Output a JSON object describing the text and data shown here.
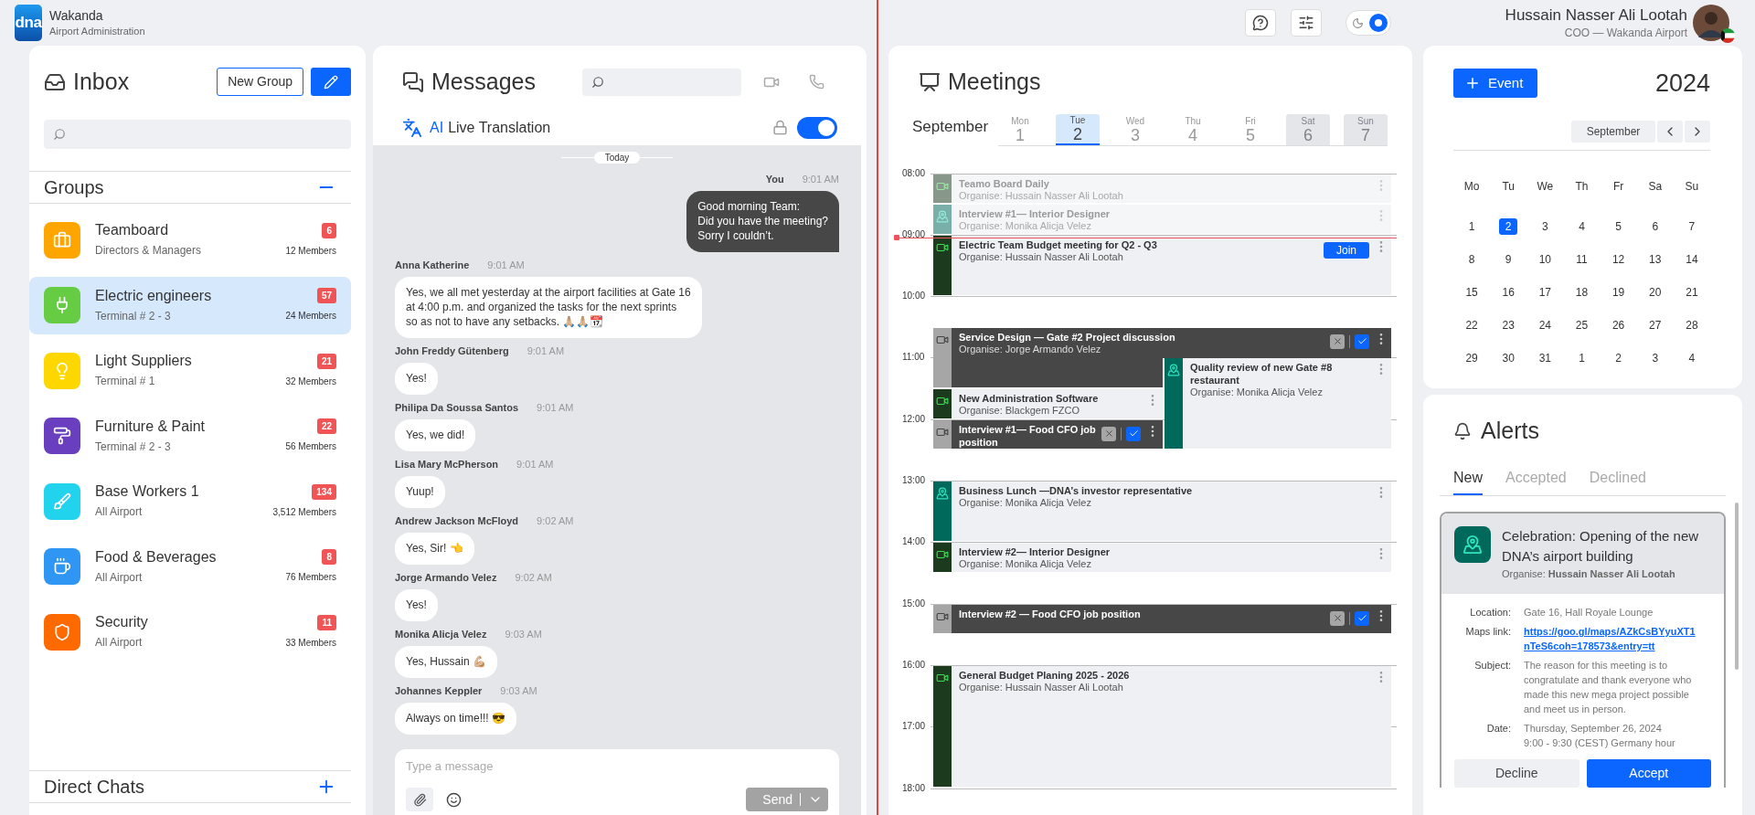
{
  "app": {
    "logo": "dna",
    "name": "Wakanda",
    "subtitle": "Airport Administration"
  },
  "header": {
    "theme_toggle": {
      "on": true
    },
    "user": {
      "name": "Hussain Nasser Ali Lootah",
      "role": "COO — Wakanda Airport"
    }
  },
  "inbox": {
    "title": "Inbox",
    "new_group": "New Group",
    "groups_title": "Groups",
    "direct_chats_title": "Direct Chats",
    "groups": [
      {
        "name": "Teamboard",
        "subtitle": "Directors & Managers",
        "unread": "6",
        "members": "12 Members",
        "color": "#ffa500",
        "selected": false
      },
      {
        "name": "Electric engineers",
        "subtitle": "Terminal # 2 - 3",
        "unread": "57",
        "members": "24 Members",
        "color": "#66cc44",
        "selected": true
      },
      {
        "name": "Light Suppliers",
        "subtitle": "Terminal # 1",
        "unread": "21",
        "members": "32 Members",
        "color": "#ffd700",
        "selected": false
      },
      {
        "name": "Furniture & Paint",
        "subtitle": "Terminal # 2 - 3",
        "unread": "22",
        "members": "56 Members",
        "color": "#6a3fbf",
        "selected": false
      },
      {
        "name": "Base Workers 1",
        "subtitle": "All Airport",
        "unread": "134",
        "members": "3,512 Members",
        "color": "#22d3ee",
        "selected": false
      },
      {
        "name": "Food & Beverages",
        "subtitle": "All Airport",
        "unread": "8",
        "members": "76 Members",
        "color": "#2f96f3",
        "selected": false
      },
      {
        "name": "Security",
        "subtitle": "All Airport",
        "unread": "11",
        "members": "33 Members",
        "color": "#ff6a00",
        "selected": false
      }
    ]
  },
  "messages": {
    "title": "Messages",
    "translation": {
      "prefix": "AI",
      "label": "Live Translation",
      "on": true
    },
    "divider": "Today",
    "items": [
      {
        "sender": "You",
        "time": "9:01 AM",
        "text": "Good morning Team:\nDid you have the meeting?\nSorry I couldn’t.",
        "mine": true
      },
      {
        "sender": "Anna Katherine",
        "time": "9:01 AM",
        "text": "Yes, we all met yesterday at the airport facilities at Gate 16 at 4:00 p.m. and organized the tasks for the next sprints so as not to have any setbacks. 🙏🏼🙏🏼📆",
        "mine": false
      },
      {
        "sender": "John Freddy Gütenberg",
        "time": "9:01 AM",
        "text": "Yes!",
        "mine": false
      },
      {
        "sender": "Philipa Da Soussa Santos",
        "time": "9:01 AM",
        "text": "Yes, we did!",
        "mine": false
      },
      {
        "sender": "Lisa Mary McPherson",
        "time": "9:01 AM",
        "text": "Yuup!",
        "mine": false
      },
      {
        "sender": "Andrew Jackson McFloyd",
        "time": "9:02 AM",
        "text": "Yes, Sir! 👈",
        "mine": false
      },
      {
        "sender": "Jorge Armando Velez",
        "time": "9:02 AM",
        "text": "Yes!",
        "mine": false
      },
      {
        "sender": "Monika Alicja Velez",
        "time": "9:03 AM",
        "text": "Yes, Hussain 💪🏼",
        "mine": false
      },
      {
        "sender": "Johannes Keppler",
        "time": "9:03 AM",
        "text": "Always on time!!! 😎",
        "mine": false
      }
    ],
    "composer": {
      "placeholder": "Type a message",
      "send": "Send"
    }
  },
  "meetings": {
    "title": "Meetings",
    "month": "September",
    "days": [
      {
        "weekday": "Mon",
        "day": "1",
        "selected": false,
        "weekend": false
      },
      {
        "weekday": "Tue",
        "day": "2",
        "selected": true,
        "weekend": false
      },
      {
        "weekday": "Wed",
        "day": "3",
        "selected": false,
        "weekend": false
      },
      {
        "weekday": "Thu",
        "day": "4",
        "selected": false,
        "weekend": false
      },
      {
        "weekday": "Fri",
        "day": "5",
        "selected": false,
        "weekend": false
      },
      {
        "weekday": "Sat",
        "day": "6",
        "selected": false,
        "weekend": true
      },
      {
        "weekday": "Sun",
        "day": "7",
        "selected": false,
        "weekend": true
      }
    ],
    "hours": [
      "08:00",
      "09:00",
      "10:00",
      "11:00",
      "12:00",
      "13:00",
      "14:00",
      "15:00",
      "16:00",
      "17:00",
      "18:00"
    ],
    "events": [
      {
        "title": "Teamo Board Daily",
        "organiser": "Organise: Hussain Nasser Ali Lootah",
        "kind": "video",
        "past": true
      },
      {
        "title": "Interview #1— Interior Designer",
        "organiser": "Organise: Monika Alicja Velez",
        "kind": "place",
        "past": true
      },
      {
        "title": "Electric Team Budget meeting for Q2 - Q3",
        "organiser": "Organise: Hussain Nasser Ali Lootah",
        "kind": "video",
        "past": false,
        "join": "Join"
      },
      {
        "title": "Service Design — Gate #2 Project discussion",
        "organiser": "Organise: Jorge Armando Velez",
        "kind": "pending",
        "past": false
      },
      {
        "title": "Quality review of new Gate #8 restaurant",
        "organiser": "Organise: Monika Alicja Velez",
        "kind": "place",
        "past": false
      },
      {
        "title": "New Administration Software",
        "organiser": "Organise: Blackgem FZCO",
        "kind": "video",
        "past": false
      },
      {
        "title": "Interview #1— Food CFO job position",
        "kind": "pending",
        "past": false
      },
      {
        "title": "Business Lunch —DNA’s investor representative",
        "organiser": "Organise: Monika Alicja Velez",
        "kind": "place",
        "past": false
      },
      {
        "title": "Interview #2— Interior Designer",
        "organiser": "Organise: Monika Alicja Velez",
        "kind": "video",
        "past": false
      },
      {
        "title": "Interview #2 — Food CFO job position",
        "kind": "pending",
        "past": false
      },
      {
        "title": "General Budget Planing 2025 - 2026",
        "organiser": "Organise: Hussain Nasser Ali Lootah",
        "kind": "video",
        "past": false
      }
    ]
  },
  "calendar": {
    "event_button": "Event",
    "year": "2024",
    "month": "September",
    "weekdays": [
      "Mo",
      "Tu",
      "We",
      "Th",
      "Fr",
      "Sa",
      "Su"
    ],
    "weeks": [
      [
        {
          "day": "1",
          "selected": false
        },
        {
          "day": "2",
          "selected": true
        },
        {
          "day": "3",
          "selected": false
        },
        {
          "day": "4",
          "selected": false
        },
        {
          "day": "5",
          "selected": false
        },
        {
          "day": "6",
          "selected": false
        },
        {
          "day": "7",
          "selected": false
        }
      ],
      [
        {
          "day": "8",
          "selected": false
        },
        {
          "day": "9",
          "selected": false
        },
        {
          "day": "10",
          "selected": false
        },
        {
          "day": "11",
          "selected": false
        },
        {
          "day": "12",
          "selected": false
        },
        {
          "day": "13",
          "selected": false
        },
        {
          "day": "14",
          "selected": false
        }
      ],
      [
        {
          "day": "15",
          "selected": false
        },
        {
          "day": "16",
          "selected": false
        },
        {
          "day": "17",
          "selected": false
        },
        {
          "day": "18",
          "selected": false
        },
        {
          "day": "19",
          "selected": false
        },
        {
          "day": "20",
          "selected": false
        },
        {
          "day": "21",
          "selected": false
        }
      ],
      [
        {
          "day": "22",
          "selected": false
        },
        {
          "day": "23",
          "selected": false
        },
        {
          "day": "24",
          "selected": false
        },
        {
          "day": "25",
          "selected": false
        },
        {
          "day": "26",
          "selected": false
        },
        {
          "day": "27",
          "selected": false
        },
        {
          "day": "28",
          "selected": false
        }
      ],
      [
        {
          "day": "29",
          "selected": false
        },
        {
          "day": "30",
          "selected": false
        },
        {
          "day": "31",
          "selected": false
        },
        {
          "day": "1",
          "selected": false
        },
        {
          "day": "2",
          "selected": false
        },
        {
          "day": "3",
          "selected": false
        },
        {
          "day": "4",
          "selected": false
        }
      ]
    ]
  },
  "alerts": {
    "title": "Alerts",
    "tabs": [
      {
        "label": "New",
        "selected": true
      },
      {
        "label": "Accepted",
        "selected": false
      },
      {
        "label": "Declined",
        "selected": false
      }
    ],
    "card": {
      "title": "Celebration: Opening of the new DNA’s airport building",
      "organiser": "Organise: **Hussain Nasser Ali Lootah**",
      "details": [
        {
          "label": "Location:",
          "value": "Gate 16, Hall Royale Lounge",
          "kind": "text"
        },
        {
          "label": "Maps link:",
          "value": "https://goo.gl/maps/AZkCsBYyuXT1nTeS6coh=178573&entry=tt",
          "kind": "link"
        },
        {
          "label": "Subject:",
          "value": "The reason for this meeting is to congratulate and thank everyone who made this new mega project possible and meet us in person.",
          "kind": "text"
        },
        {
          "label": "Date:",
          "value": "Thursday, September 26, 2024\n9:00 - 9:30 (CEST) Germany hour",
          "kind": "text"
        }
      ],
      "decline": "Decline",
      "accept": "Accept"
    }
  }
}
